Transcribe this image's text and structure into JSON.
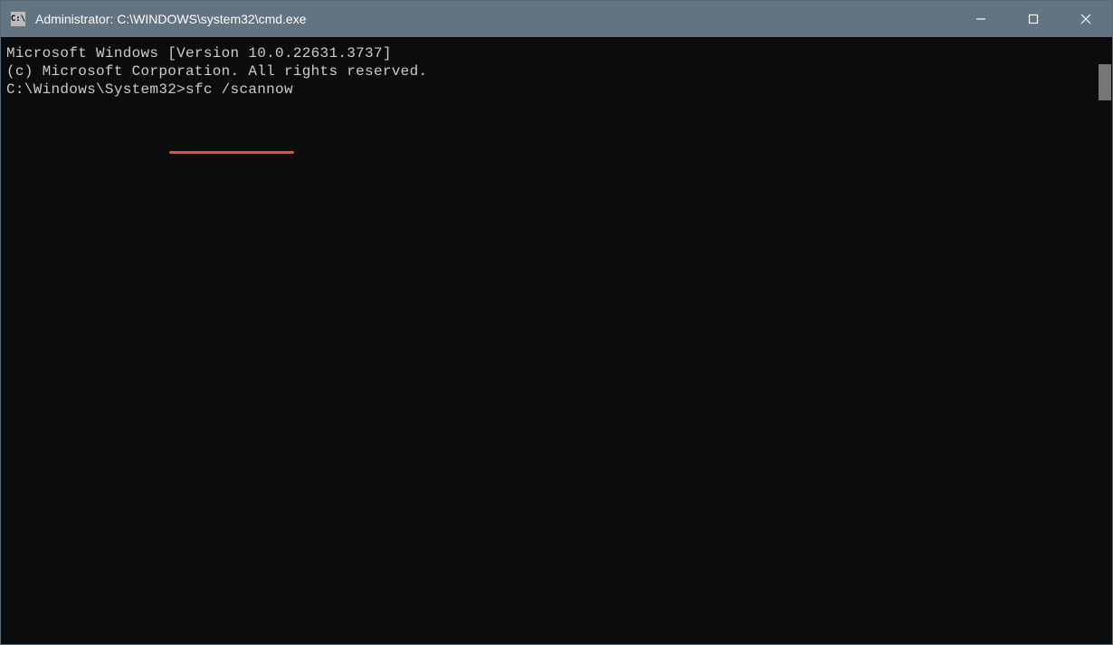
{
  "window": {
    "title": "Administrator: C:\\WINDOWS\\system32\\cmd.exe",
    "icon_label": "C:\\"
  },
  "terminal": {
    "line1": "Microsoft Windows [Version 10.0.22631.3737]",
    "line2": "(c) Microsoft Corporation. All rights reserved.",
    "blank": "",
    "prompt": "C:\\Windows\\System32>",
    "command": "sfc /scannow"
  },
  "annotation": {
    "underline_color": "#e74c3c"
  }
}
